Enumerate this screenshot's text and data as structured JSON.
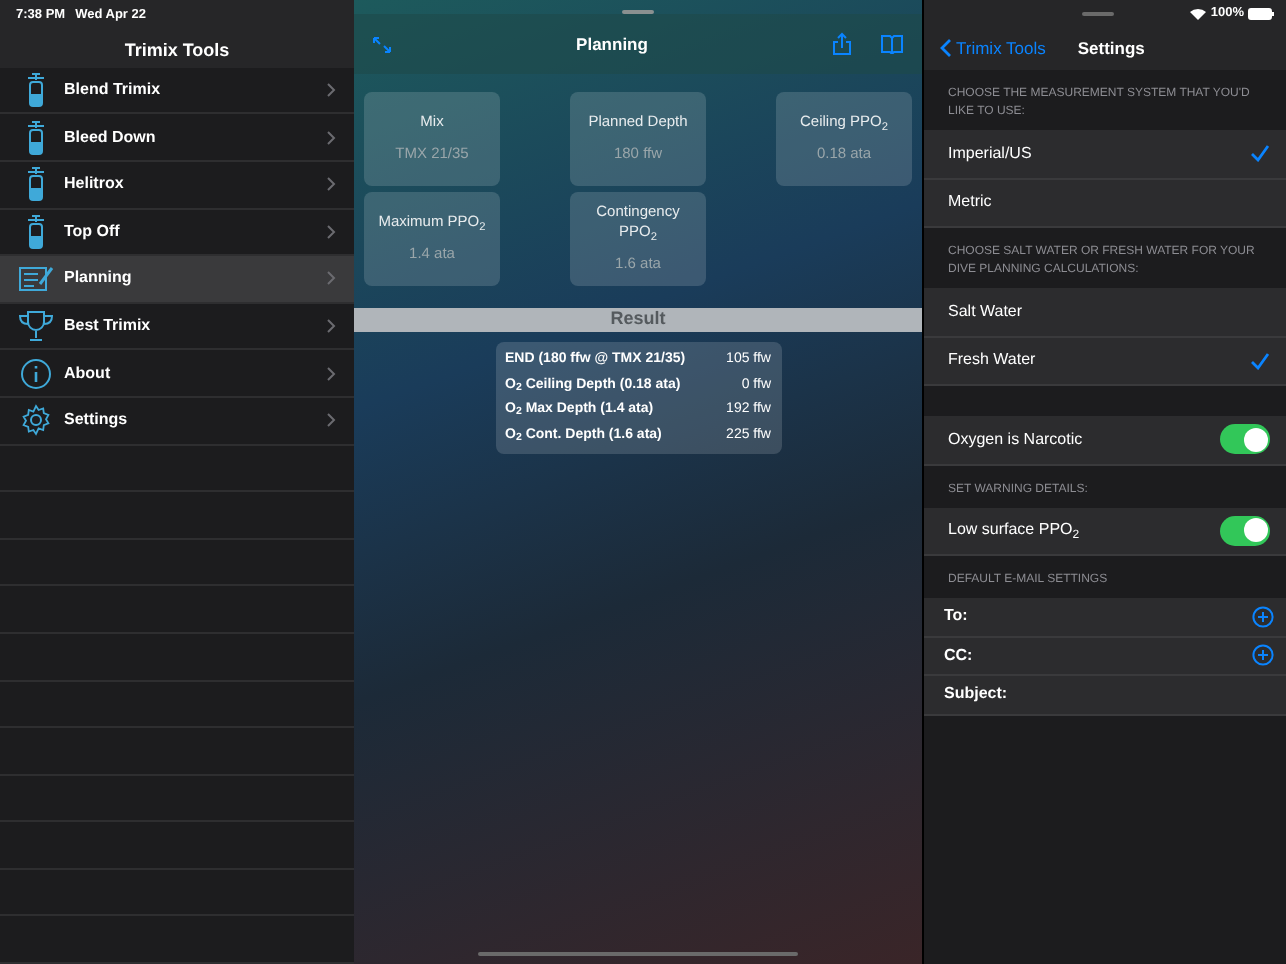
{
  "status_bar": {
    "time": "7:38 PM",
    "date": "Wed Apr 22",
    "battery": "100%"
  },
  "sidebar": {
    "title": "Trimix Tools",
    "items": [
      {
        "label": "Blend Trimix",
        "kind": "tank",
        "selected": false
      },
      {
        "label": "Bleed Down",
        "kind": "tank",
        "selected": false
      },
      {
        "label": "Helitrox",
        "kind": "tank",
        "selected": false
      },
      {
        "label": "Top Off",
        "kind": "tank",
        "selected": false
      },
      {
        "label": "Planning",
        "kind": "planning",
        "selected": true
      },
      {
        "label": "Best Trimix",
        "kind": "trophy",
        "selected": false
      },
      {
        "label": "About",
        "kind": "info",
        "selected": false
      },
      {
        "label": "Settings",
        "kind": "gear",
        "selected": false
      }
    ]
  },
  "planning": {
    "title": "Planning",
    "inputs": [
      {
        "label": "Mix",
        "value": "TMX 21/35"
      },
      {
        "label": "Planned Depth",
        "value": "180 ffw"
      },
      {
        "label": "Ceiling PPO$_{2}$",
        "value": "0.18 ata"
      },
      {
        "label": "Maximum PPO$_{2}$",
        "value": "1.4 ata"
      },
      {
        "label": "Contingency PPO$_{2}$",
        "value": "1.6 ata"
      }
    ],
    "result_title": "Result",
    "results": [
      {
        "label": "END (180 ffw @ TMX 21/35)",
        "value": "105 ffw"
      },
      {
        "label": "O$_{2}$ Ceiling Depth (0.18 ata)",
        "value": "0 ffw"
      },
      {
        "label": "O$_{2}$ Max Depth (1.4 ata)",
        "value": "192 ffw"
      },
      {
        "label": "O$_{2}$ Cont. Depth (1.6 ata)",
        "value": "225 ffw"
      }
    ]
  },
  "settings": {
    "back": "Trimix Tools",
    "title": "Settings",
    "sections": [
      {
        "header": "CHOOSE THE MEASUREMENT SYSTEM THAT YOU'D LIKE TO USE:",
        "rows": [
          {
            "label": "Imperial/US",
            "kind": "choice",
            "selected": true
          },
          {
            "label": "Metric",
            "kind": "choice",
            "selected": false
          }
        ]
      },
      {
        "header": "CHOOSE SALT WATER OR FRESH WATER FOR YOUR DIVE PLANNING CALCULATIONS:",
        "rows": [
          {
            "label": "Salt Water",
            "kind": "choice",
            "selected": false
          },
          {
            "label": "Fresh Water",
            "kind": "choice",
            "selected": true
          }
        ]
      },
      {
        "rows": [
          {
            "label": "Oxygen is Narcotic",
            "kind": "toggle",
            "on": true
          }
        ]
      },
      {
        "header": "SET WARNING DETAILS:",
        "rows": [
          {
            "label": "Low surface PPO$_{2}$",
            "kind": "toggle",
            "on": true
          }
        ]
      },
      {
        "header": "DEFAULT E-MAIL SETTINGS",
        "rows": [
          {
            "label": "To:",
            "kind": "add"
          },
          {
            "label": "CC:",
            "kind": "add"
          },
          {
            "label": "Subject:",
            "kind": "field"
          }
        ]
      }
    ]
  }
}
